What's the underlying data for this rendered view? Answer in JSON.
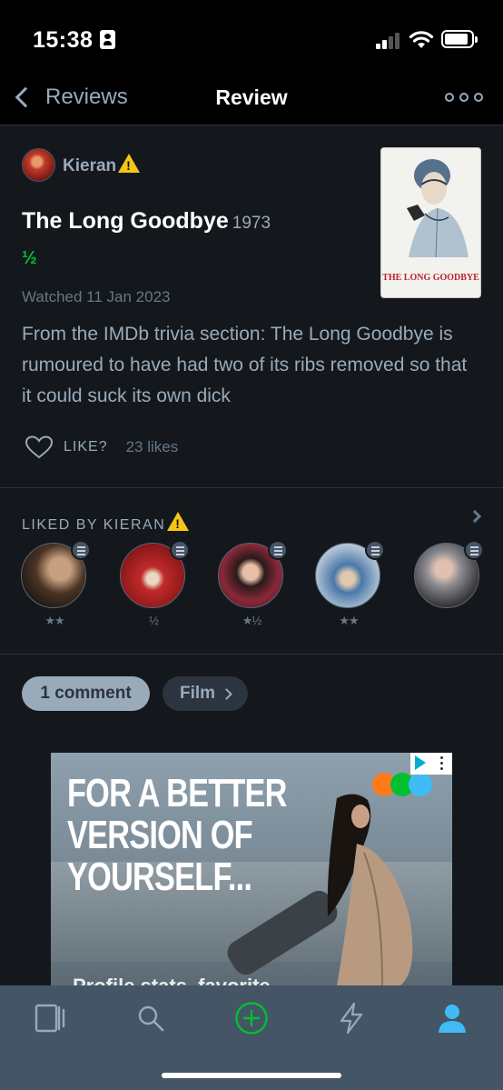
{
  "status_bar": {
    "time": "15:38"
  },
  "nav": {
    "back_label": "Reviews",
    "title": "Review"
  },
  "review": {
    "author": "Kieran",
    "film_title": "The Long Goodbye",
    "year": "1973",
    "rating": "½",
    "watched": "Watched 11 Jan 2023",
    "body": "From the IMDb trivia section: The Long Goodbye is rumoured to have had two of its ribs removed so that it could suck its own dick",
    "like_label": "LIKE?",
    "likes": "23 likes",
    "poster_text": "THE LONG GOODBYE"
  },
  "liked_by": {
    "title": "LIKED BY KIERAN",
    "items": [
      {
        "stars": "★★",
        "color": "#3a2a1e"
      },
      {
        "stars": "½",
        "color": "#b3282b"
      },
      {
        "stars": "★½",
        "color": "#7a2030"
      },
      {
        "stars": "★★",
        "color": "#8aa6c0"
      },
      {
        "stars": "",
        "color": "#4a4648"
      }
    ]
  },
  "buttons": {
    "comments": "1 comment",
    "film": "Film"
  },
  "ad": {
    "headline_1": "FOR A BETTER",
    "headline_2": "VERSION OF",
    "headline_3": "YOURSELF...",
    "subtext": "Profile stats, favorite"
  },
  "tabs": [
    {
      "icon": "films-icon"
    },
    {
      "icon": "search-icon"
    },
    {
      "icon": "add-icon"
    },
    {
      "icon": "activity-icon"
    },
    {
      "icon": "profile-icon"
    }
  ],
  "colors": {
    "background": "#14181c",
    "accent_green": "#00c030",
    "muted": "#99aabb",
    "profile_blue": "#40bcf4",
    "tab_bar": "#445566"
  }
}
